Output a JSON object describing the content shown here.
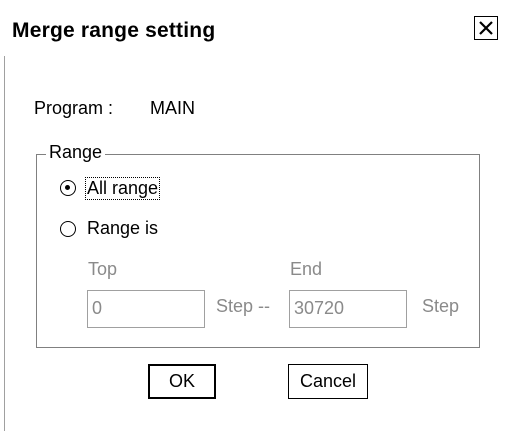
{
  "dialog": {
    "title": "Merge range setting",
    "close_icon": "close-icon"
  },
  "program": {
    "label": "Program :",
    "value": "MAIN"
  },
  "range": {
    "group_label": "Range",
    "options": [
      {
        "label": "All range",
        "selected": true
      },
      {
        "label": "Range is",
        "selected": false
      }
    ],
    "top_label": "Top",
    "end_label": "End",
    "top_value": "0",
    "end_value": "30720",
    "step_sep_label": "Step --",
    "step_label": "Step"
  },
  "buttons": {
    "ok": "OK",
    "cancel": "Cancel"
  }
}
